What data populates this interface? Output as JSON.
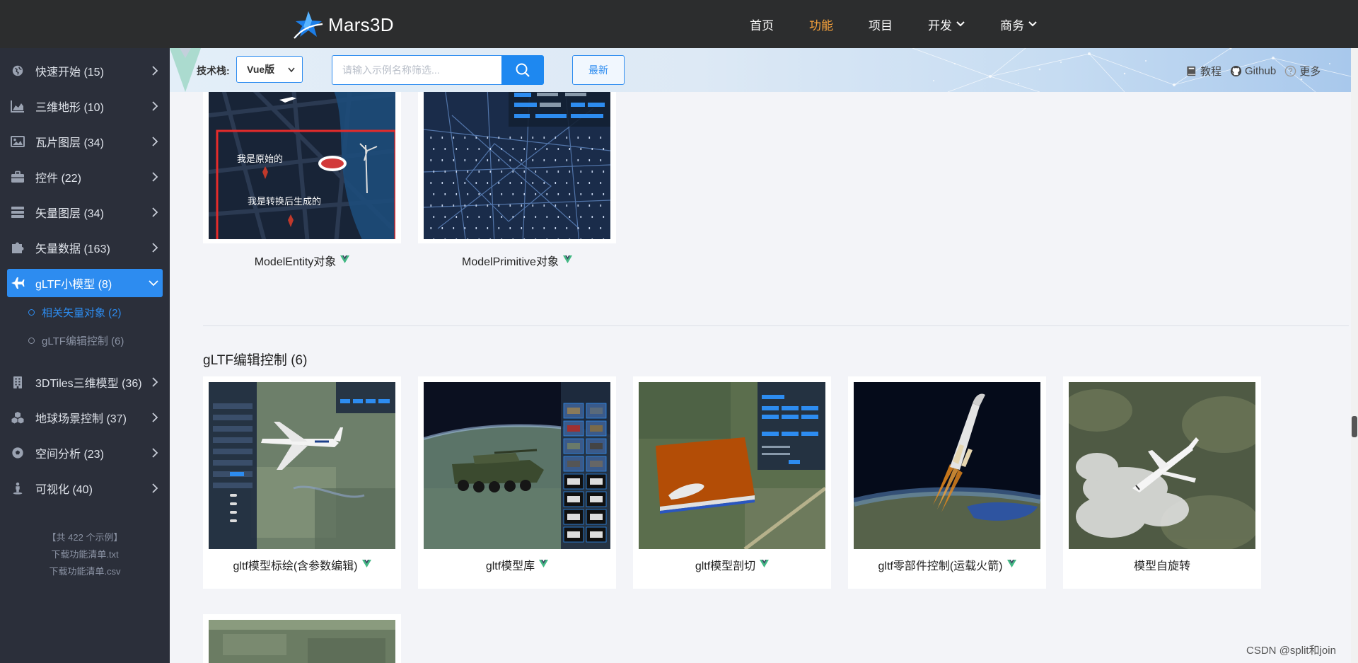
{
  "brand": {
    "name": "Mars3D"
  },
  "nav": [
    {
      "label": "首页",
      "active": false,
      "dropdown": false
    },
    {
      "label": "功能",
      "active": true,
      "dropdown": false
    },
    {
      "label": "项目",
      "active": false,
      "dropdown": false
    },
    {
      "label": "开发",
      "active": false,
      "dropdown": true
    },
    {
      "label": "商务",
      "active": false,
      "dropdown": true
    }
  ],
  "sidebar": {
    "items": [
      {
        "label": "快速开始 (15)",
        "icon": "globe-icon"
      },
      {
        "label": "三维地形 (10)",
        "icon": "area-chart-icon"
      },
      {
        "label": "瓦片图层 (34)",
        "icon": "image-icon"
      },
      {
        "label": "控件 (22)",
        "icon": "briefcase-icon"
      },
      {
        "label": "矢量图层 (34)",
        "icon": "server-icon"
      },
      {
        "label": "矢量数据 (163)",
        "icon": "puzzle-icon"
      },
      {
        "label": "gLTF小模型 (8)",
        "icon": "plane-icon"
      },
      {
        "label": "3DTiles三维模型 (36)",
        "icon": "building-icon"
      },
      {
        "label": "地球场景控制 (37)",
        "icon": "cubes-icon"
      },
      {
        "label": "空间分析 (23)",
        "icon": "soccer-icon"
      },
      {
        "label": "可视化 (40)",
        "icon": "street-view-icon"
      }
    ],
    "subitems": [
      {
        "label": "相关矢量对象 (2)",
        "active": true
      },
      {
        "label": "gLTF编辑控制 (6)",
        "active": false
      }
    ],
    "footer": {
      "count_text": "【共 422 个示例】",
      "download_txt": "下载功能清单.txt",
      "download_csv": "下载功能清单.csv"
    }
  },
  "toolbar": {
    "tech_label": "技术栈:",
    "tech_value": "Vue版",
    "search_placeholder": "请输入示例名称筛选...",
    "newest_label": "最新",
    "links": [
      {
        "label": "教程",
        "icon": "book-icon"
      },
      {
        "label": "Github",
        "icon": "github-icon"
      },
      {
        "label": "更多",
        "icon": "help-circle-icon"
      }
    ]
  },
  "sections": [
    {
      "title": "",
      "cards": [
        {
          "caption": "ModelEntity对象",
          "vue": true,
          "overlay_1": "我是原始的",
          "overlay_2": "我是转换后生成的"
        },
        {
          "caption": "ModelPrimitive对象",
          "vue": true
        }
      ]
    },
    {
      "title": "gLTF编辑控制 (6)",
      "cards": [
        {
          "caption": "gltf模型标绘(含参数编辑)",
          "vue": true
        },
        {
          "caption": "gltf模型库",
          "vue": true
        },
        {
          "caption": "gltf模型剖切",
          "vue": true
        },
        {
          "caption": "gltf零部件控制(运载火箭)",
          "vue": true
        },
        {
          "caption": "模型自旋转",
          "vue": false
        }
      ]
    }
  ],
  "watermark": "CSDN @split和join",
  "colors": {
    "accent": "#2d8cf0",
    "nav_active": "#f7a23b",
    "vue_badge": "#41b883"
  }
}
